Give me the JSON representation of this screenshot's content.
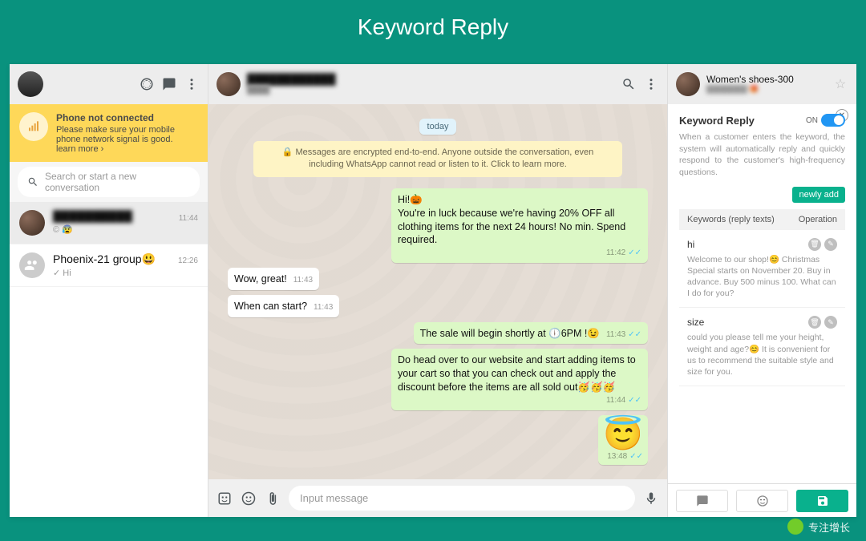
{
  "page_title": "Keyword Reply",
  "banner": {
    "title": "Phone not connected",
    "desc": "Please make sure your mobile phone network signal is good.",
    "learn_more": "learn more ›"
  },
  "search_placeholder": "Search or start a new conversation",
  "chat_list": [
    {
      "name_hidden": "██████████",
      "time": "11:44",
      "preview": "© 😰",
      "active": true
    },
    {
      "name": "Phoenix-21 group😃",
      "time": "12:26",
      "preview": "✓ Hi",
      "active": false
    }
  ],
  "chat_header": {
    "name_hidden": "████████████",
    "status_hidden": "████"
  },
  "messages": {
    "date": "today",
    "encryption": "🔒 Messages are encrypted end-to-end. Anyone outside the conversation, even including WhatsApp cannot read or listen to it. Click to learn more.",
    "items": [
      {
        "dir": "out",
        "text": "Hi!🎃\nYou're in luck because we're having 20% OFF all clothing items for the next 24 hours! No min. Spend required.",
        "time": "11:42",
        "ticks": true
      },
      {
        "dir": "in",
        "text": "Wow, great!",
        "time": "11:43"
      },
      {
        "dir": "in",
        "text": "When can start?",
        "time": "11:43"
      },
      {
        "dir": "out",
        "text": "The sale will begin shortly at 🕕6PM !😉",
        "time": "11:43",
        "ticks": true
      },
      {
        "dir": "out",
        "text": "Do head over to our website and start adding items to your cart so that you can check out and apply the discount before the items are all sold out🥳🥳🥳",
        "time": "11:44",
        "ticks": true
      },
      {
        "dir": "out",
        "emoji": "😇",
        "time": "13:48",
        "ticks": true
      }
    ]
  },
  "input_placeholder": "Input message",
  "right_panel": {
    "header": {
      "title": "Women's shoes-300",
      "sub_hidden": "████████ 🎁"
    },
    "title": "Keyword Reply",
    "toggle_label": "ON",
    "desc": "When a customer enters the keyword, the system will automatically reply and quickly respond to the customer's high-frequency questions.",
    "add_button": "newly add",
    "table_header": {
      "col1": "Keywords (reply texts)",
      "col2": "Operation"
    },
    "keywords": [
      {
        "kw": "hi",
        "reply": "Welcome to our shop!😊 Christmas Special starts on November 20. Buy in advance. Buy 500 minus 100. What can I do for you?"
      },
      {
        "kw": "size",
        "reply": "could you please tell me your height, weight and age?😊 It is convenient for us to recommend the suitable style and size for you."
      }
    ]
  },
  "watermark": "专注增长"
}
